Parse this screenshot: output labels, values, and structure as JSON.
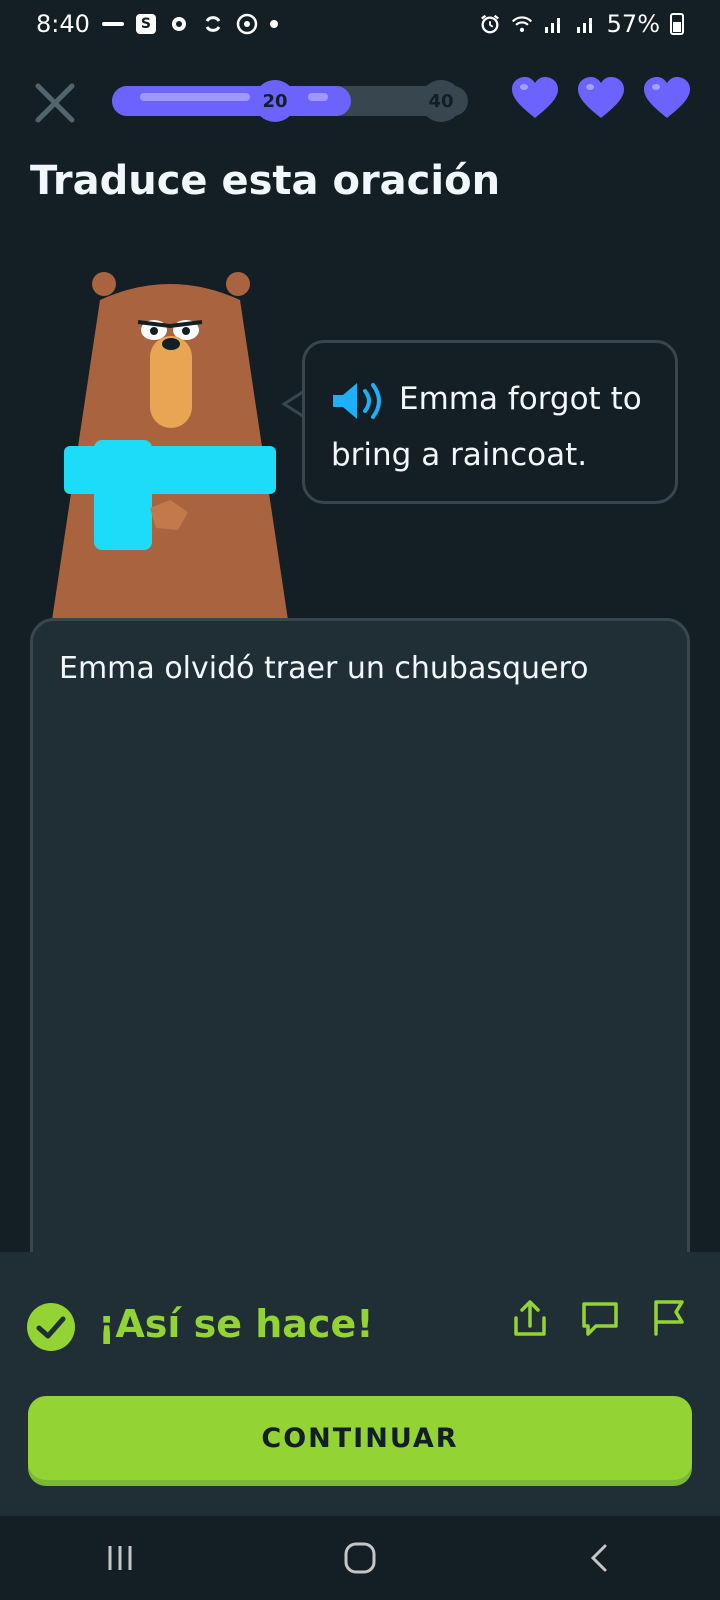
{
  "status_bar": {
    "time": "8:40",
    "battery": "57%",
    "icons": [
      "notification-small-icon",
      "s-box-icon",
      "settings-cog-icon",
      "sync-icon",
      "target-icon",
      "dot-icon",
      "alarm-icon",
      "wifi-icon",
      "signal-icon",
      "signal-icon",
      "battery-icon"
    ]
  },
  "top_bar": {
    "progress_current": "20",
    "progress_next": "40",
    "progress_fraction": 0.67,
    "hearts": 3,
    "accent_color": "#6c63ff"
  },
  "lesson": {
    "title": "Traduce esta oración",
    "prompt_text": "Emma forgot to bring a raincoat.",
    "answer_text": "Emma olvidó traer un chubasquero"
  },
  "feedback": {
    "message": "¡Así se hace!",
    "color": "#93d333",
    "continue_label": "CONTINUAR"
  },
  "nav": {
    "items": [
      "recent-apps",
      "home",
      "back"
    ]
  }
}
